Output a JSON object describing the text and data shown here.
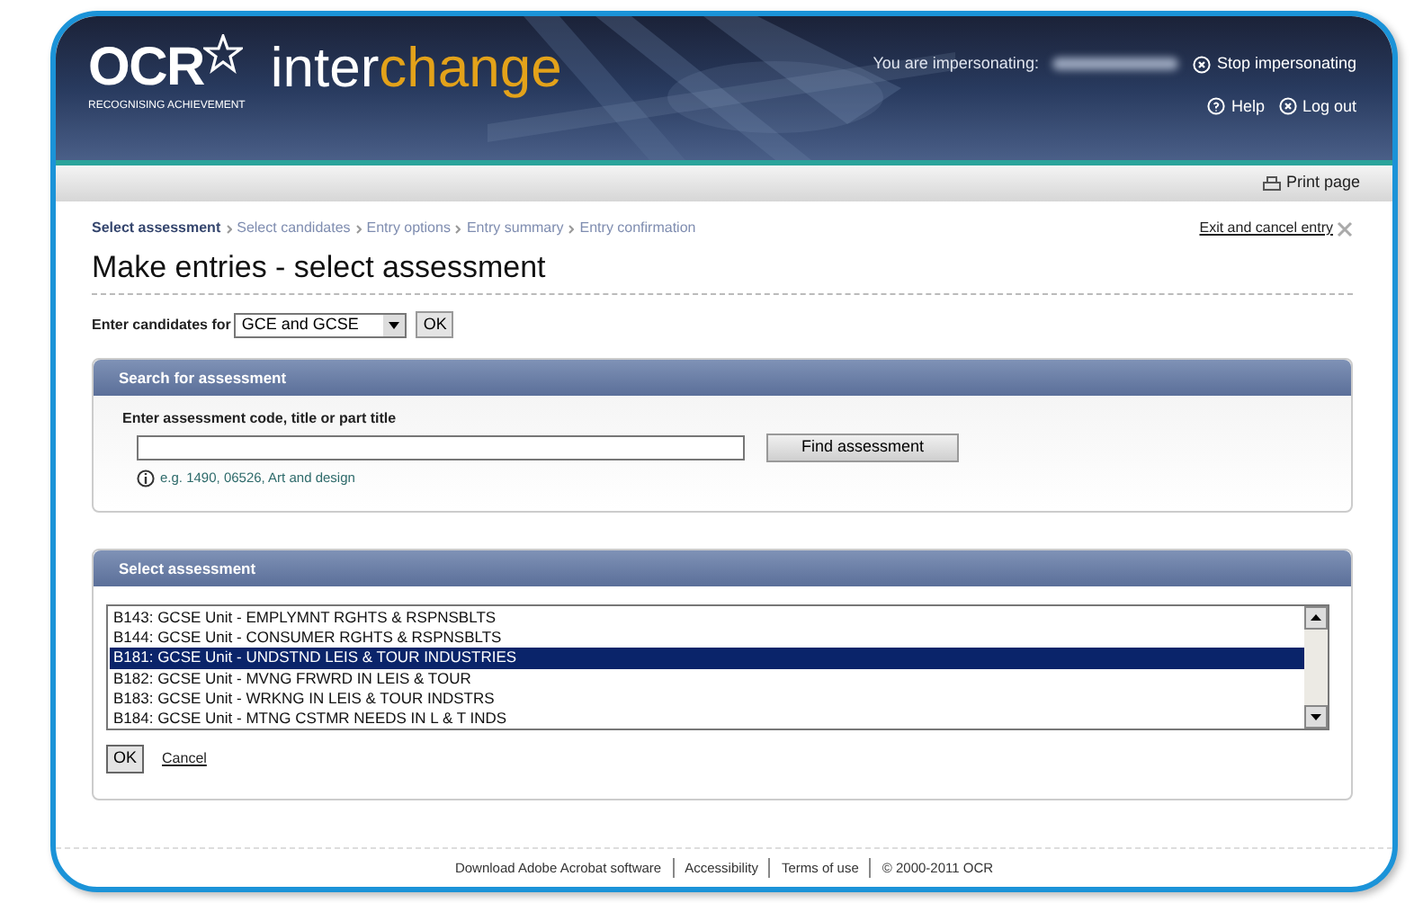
{
  "header": {
    "logo": "OCR",
    "logo_tagline": "RECOGNISING ACHIEVEMENT",
    "brand_first": "inter",
    "brand_second": "change",
    "impersonating_label": "You are impersonating:",
    "links": [
      {
        "kind": "stop",
        "label": "Stop impersonating"
      },
      {
        "kind": "help",
        "label": "Help"
      },
      {
        "kind": "logout",
        "label": "Log out"
      }
    ]
  },
  "toolbar": {
    "print": "Print page"
  },
  "breadcrumb": [
    {
      "label": "Select assessment",
      "selected": true
    },
    {
      "label": "Select candidates",
      "selected": false
    },
    {
      "label": "Entry options",
      "selected": false
    },
    {
      "label": "Entry summary",
      "selected": false
    },
    {
      "label": "Entry confirmation",
      "selected": false
    }
  ],
  "exit_link": "Exit and cancel entry",
  "title": "Make entries - select assessment",
  "qualification": {
    "label": "Enter candidates for",
    "value": "GCE and GCSE",
    "button": "OK"
  },
  "search_panel": {
    "heading": "Search for assessment",
    "field_label": "Enter assessment code, title or part title",
    "button": "Find assessment",
    "hint": "e.g. 1490, 06526, Art and design"
  },
  "select_panel": {
    "heading": "Select assessment",
    "options": [
      {
        "label": "B143: GCSE Unit - EMPLYMNT RGHTS & RSPNSBLTS",
        "selected": false
      },
      {
        "label": "B144: GCSE Unit - CONSUMER RGHTS & RSPNSBLTS",
        "selected": false
      },
      {
        "label": "B181: GCSE Unit - UNDSTND LEIS & TOUR INDUSTRIES",
        "selected": true
      },
      {
        "label": "B182: GCSE Unit - MVNG FRWRD IN LEIS & TOUR",
        "selected": false
      },
      {
        "label": "B183: GCSE Unit - WRKNG IN LEIS & TOUR INDSTRS",
        "selected": false
      },
      {
        "label": "B184: GCSE Unit - MTNG CSTMR NEEDS IN L & T INDS",
        "selected": false
      }
    ],
    "ok": "OK",
    "cancel": "Cancel"
  },
  "footer": [
    "Download Adobe Acrobat software",
    "Accessibility",
    "Terms of use",
    "© 2000-2011 OCR"
  ]
}
